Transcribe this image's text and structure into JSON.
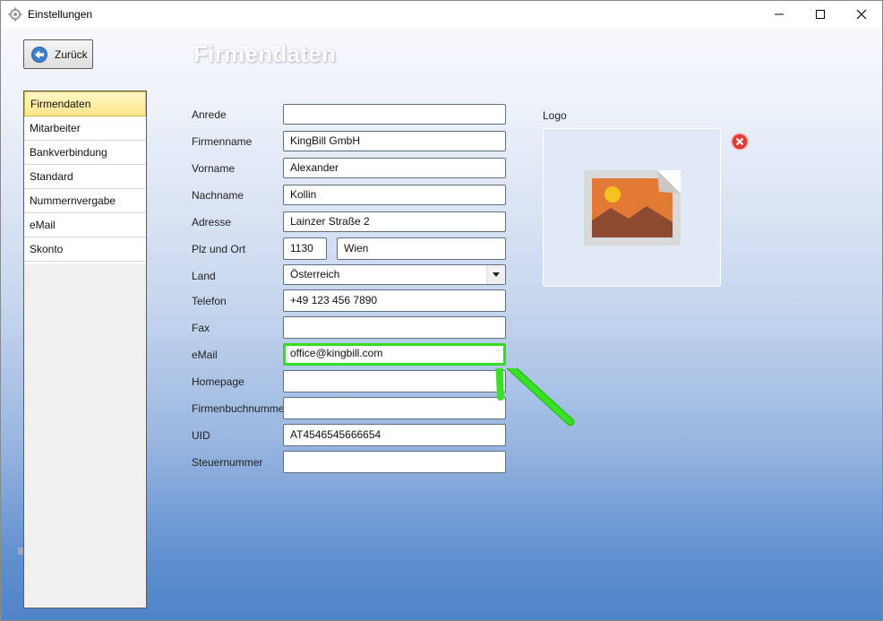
{
  "window": {
    "title": "Einstellungen"
  },
  "toolbar": {
    "back_label": "Zurück"
  },
  "page": {
    "title": "Firmendaten"
  },
  "sidebar": {
    "items": [
      {
        "label": "Firmendaten",
        "active": true
      },
      {
        "label": "Mitarbeiter"
      },
      {
        "label": "Bankverbindung"
      },
      {
        "label": "Standard"
      },
      {
        "label": "Nummernvergabe"
      },
      {
        "label": "eMail"
      },
      {
        "label": "Skonto"
      }
    ]
  },
  "form": {
    "anrede": {
      "label": "Anrede",
      "value": ""
    },
    "firmenname": {
      "label": "Firmenname",
      "value": "KingBill GmbH"
    },
    "vorname": {
      "label": "Vorname",
      "value": "Alexander"
    },
    "nachname": {
      "label": "Nachname",
      "value": "Kollin"
    },
    "adresse": {
      "label": "Adresse",
      "value": "Lainzer Straße 2"
    },
    "plz_ort": {
      "label": "Plz und Ort",
      "plz": "1130",
      "ort": "Wien"
    },
    "land": {
      "label": "Land",
      "value": "Österreich"
    },
    "telefon": {
      "label": "Telefon",
      "value": "+49 123 456 7890"
    },
    "fax": {
      "label": "Fax",
      "value": ""
    },
    "email": {
      "label": "eMail",
      "value": "office@kingbill.com"
    },
    "homepage": {
      "label": "Homepage",
      "value": ""
    },
    "firmenbuchnummer": {
      "label": "Firmenbuchnummer",
      "value": ""
    },
    "uid": {
      "label": "UID",
      "value": "AT4546545666654"
    },
    "steuernummer": {
      "label": "Steuernummer",
      "value": ""
    }
  },
  "logo": {
    "label": "Logo",
    "icon": "image-placeholder-icon"
  },
  "colors": {
    "highlight": "#33dd22",
    "active_item": "#fde68a",
    "remove": "#e53935"
  }
}
